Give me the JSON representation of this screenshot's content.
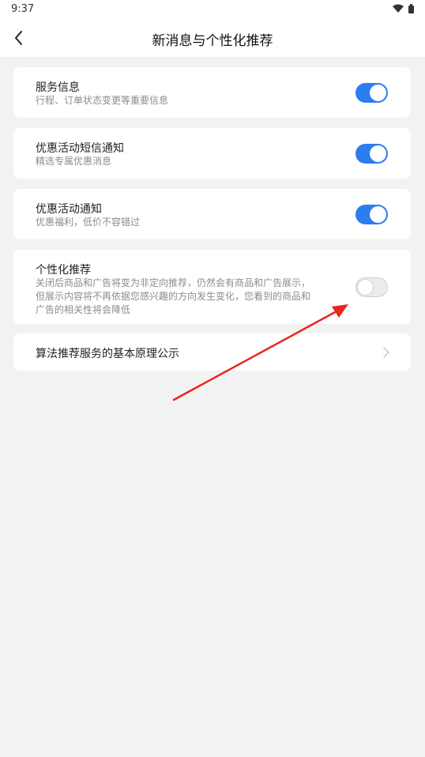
{
  "statusbar": {
    "time": "9:37"
  },
  "navbar": {
    "title": "新消息与个性化推荐"
  },
  "settings": [
    {
      "title": "服务信息",
      "desc": "行程、订单状态变更等重要信息",
      "enabled": true
    },
    {
      "title": "优惠活动短信通知",
      "desc": "精选专属优惠消息",
      "enabled": true
    },
    {
      "title": "优惠活动通知",
      "desc": "优惠福利，低价不容错过",
      "enabled": true
    },
    {
      "title": "个性化推荐",
      "desc_lines": [
        "关闭后商品和广告将变为非定向推荐，仍然会有商品和广告展示，",
        "但展示内容将不再依据您感兴趣的方向发生变化，您看到的商品和",
        "广告的相关性将会降低"
      ],
      "enabled": false
    }
  ],
  "algorithm_link": {
    "label": "算法推荐服务的基本原理公示"
  },
  "annotation": {
    "arrow_color": "#e8261c"
  },
  "colors": {
    "accent": "#2b7df0",
    "background": "#f2f2f2"
  }
}
